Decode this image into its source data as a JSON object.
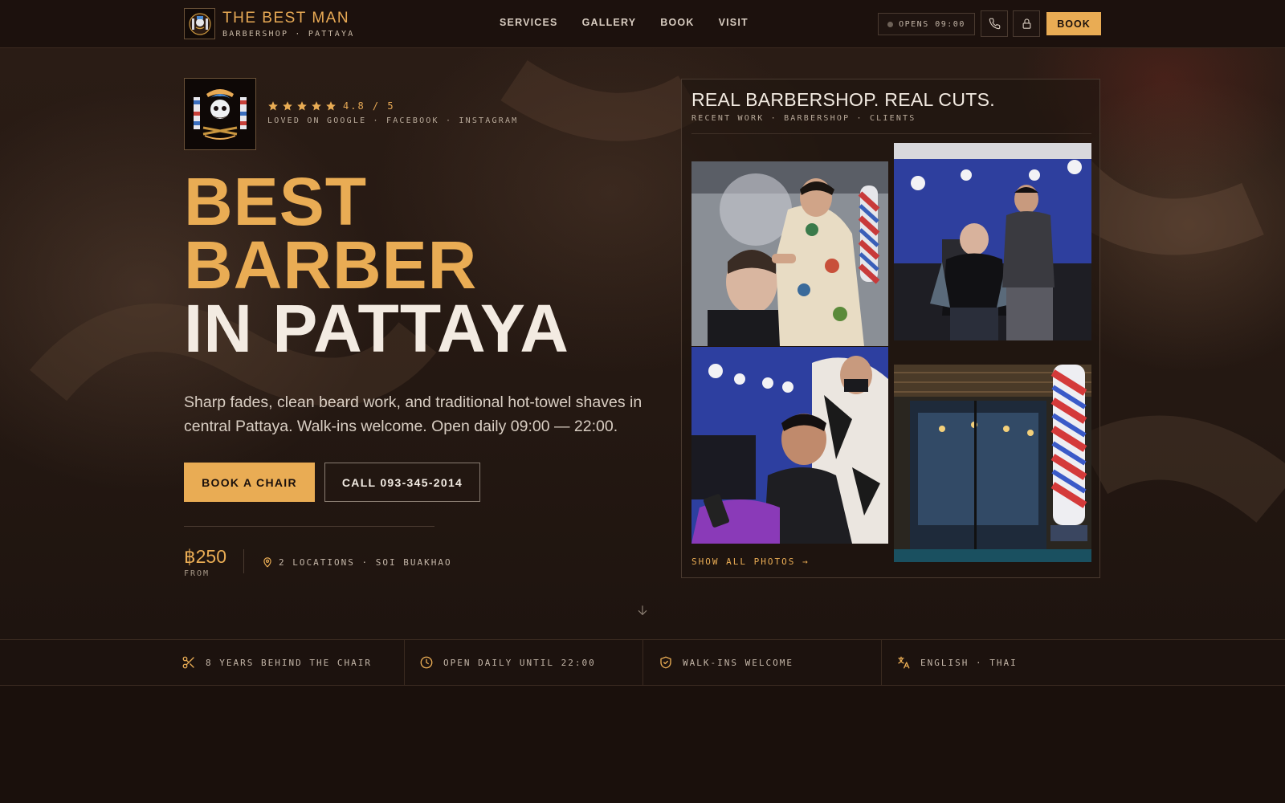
{
  "brand": {
    "name": "THE BEST MAN",
    "sub": "BARBERSHOP · PATTAYA"
  },
  "nav": {
    "items": [
      "SERVICES",
      "GALLERY",
      "BOOK",
      "VISIT"
    ]
  },
  "header": {
    "opens": "OPENS 09:00",
    "book_label": "BOOK"
  },
  "hero": {
    "rating": "4.8 / 5",
    "rating_value": 4.8,
    "loved": "LOVED ON GOOGLE · FACEBOOK · INSTAGRAM",
    "headline_line1": "BEST",
    "headline_line2": "BARBER",
    "headline_line3": "IN PATTAYA",
    "tagline": "Sharp fades, clean beard work, and traditional hot-towel shaves in central Pattaya. Walk-ins welcome. Open daily 09:00 — 22:00.",
    "cta_book": "BOOK A CHAIR",
    "cta_call": "CALL 093-345-2014",
    "price": "฿250",
    "price_from": "FROM",
    "locations": "2 LOCATIONS · SOI BUAKHAO"
  },
  "gallery": {
    "title": "REAL BARBERSHOP. REAL CUTS.",
    "sub": "RECENT WORK · BARBERSHOP · CLIENTS",
    "show_all": "SHOW ALL PHOTOS →"
  },
  "features": [
    {
      "icon": "scissors-icon",
      "label": "8 YEARS BEHIND THE CHAIR"
    },
    {
      "icon": "clock-icon",
      "label": "OPEN DAILY UNTIL 22:00"
    },
    {
      "icon": "shield-check-icon",
      "label": "WALK-INS WELCOME"
    },
    {
      "icon": "translate-icon",
      "label": "ENGLISH · THAI"
    }
  ],
  "colors": {
    "accent": "#e9ac54",
    "background": "#1a100c",
    "text": "#efe6dc"
  }
}
